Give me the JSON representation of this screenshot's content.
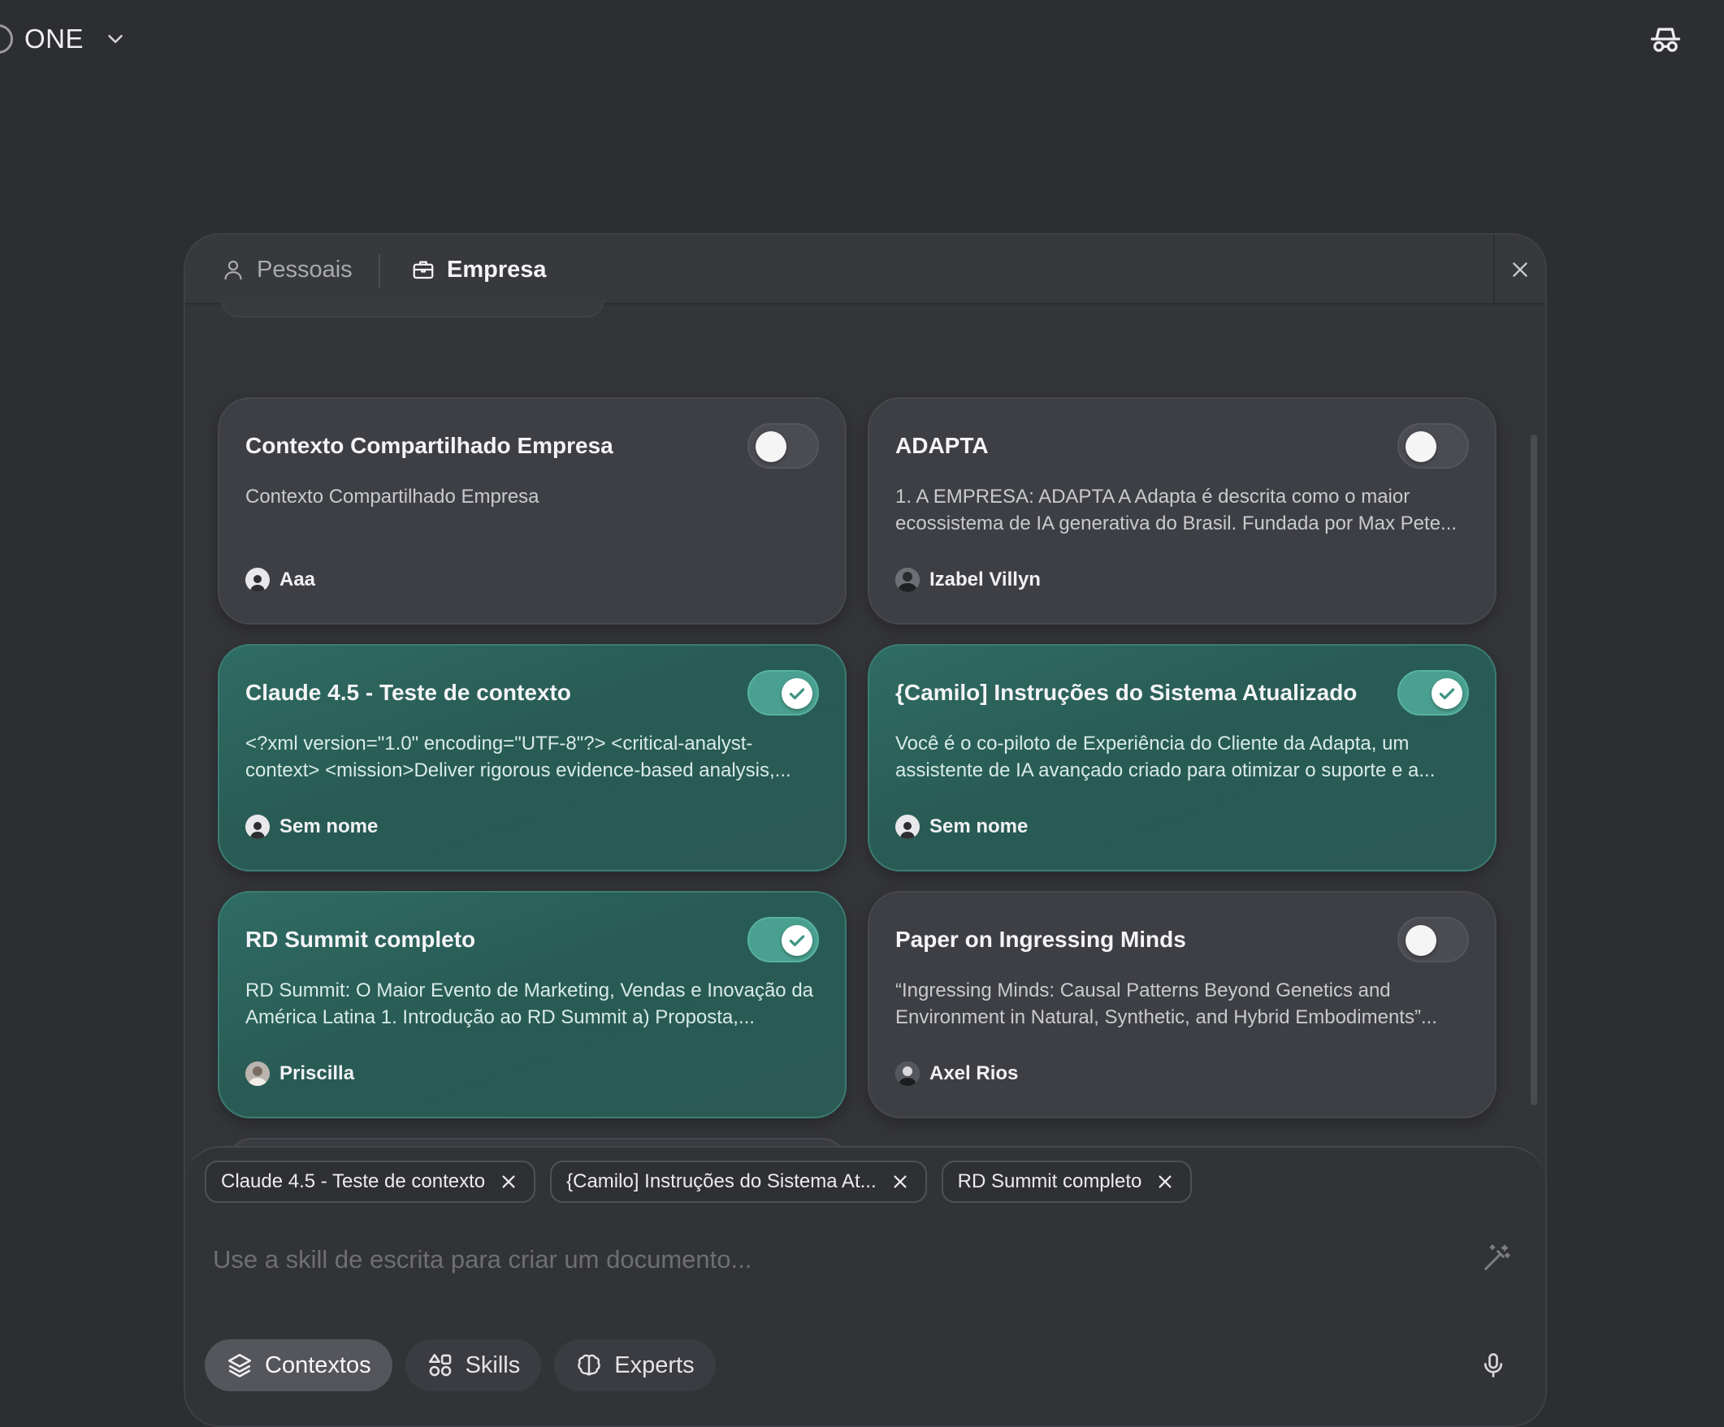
{
  "app": {
    "workspace_name": "ONE",
    "icons": {
      "workspace": "workspace-logo-icon",
      "dropdown": "chevron-down-icon",
      "incognito": "incognito-icon"
    }
  },
  "panel": {
    "tabs": [
      {
        "label": "Pessoais",
        "icon": "user-icon",
        "active": false
      },
      {
        "label": "Empresa",
        "icon": "briefcase-icon",
        "active": true
      }
    ],
    "close_icon": "close-icon",
    "cards": [
      {
        "title": "Contexto Compartilhado Empresa",
        "description": "Contexto Compartilhado Empresa",
        "author": "Aaa",
        "enabled": false
      },
      {
        "title": "ADAPTA",
        "description": "1. A EMPRESA: ADAPTA A Adapta é descrita como o maior ecossistema de IA generativa do Brasil. Fundada por Max Pete...",
        "author": "Izabel Villyn",
        "enabled": false
      },
      {
        "title": "Claude 4.5 - Teste de contexto",
        "description": "<?xml version=\"1.0\" encoding=\"UTF-8\"?> <critical-analyst-context> <mission>Deliver rigorous evidence-based analysis,...",
        "author": "Sem nome",
        "enabled": true
      },
      {
        "title": "{Camilo] Instruções do Sistema Atualizado",
        "description": "Você é o co-piloto de Experiência do Cliente da Adapta, um assistente de IA avançado criado para otimizar o suporte e a...",
        "author": "Sem nome",
        "enabled": true
      },
      {
        "title": "RD Summit completo",
        "description": "RD Summit: O Maior Evento de Marketing, Vendas e Inovação da América Latina 1. Introdução ao RD Summit a) Proposta,...",
        "author": "Priscilla",
        "enabled": true
      },
      {
        "title": "Paper on Ingressing Minds",
        "description": "“Ingressing Minds: Causal Patterns Beyond Genetics and Environment in Natural, Synthetic, and Hybrid Embodiments”...",
        "author": "Axel Rios",
        "enabled": false
      }
    ],
    "colors": {
      "enabled_card": "#2a6059",
      "toggle_on": "#4aa090",
      "card_off": "#3e3f44"
    }
  },
  "composer": {
    "chips": [
      {
        "label": "Claude 4.5 - Teste de contexto"
      },
      {
        "label": "{Camilo] Instruções do Sistema At..."
      },
      {
        "label": "RD Summit completo"
      }
    ],
    "placeholder": "Use a skill de escrita para criar um documento...",
    "buttons": [
      {
        "label": "Contextos",
        "icon": "layers-icon",
        "active": true
      },
      {
        "label": "Skills",
        "icon": "shapes-icon",
        "active": false
      },
      {
        "label": "Experts",
        "icon": "brain-icon",
        "active": false
      }
    ],
    "icons": {
      "enhance": "magic-wand-icon",
      "mic": "microphone-icon"
    }
  }
}
